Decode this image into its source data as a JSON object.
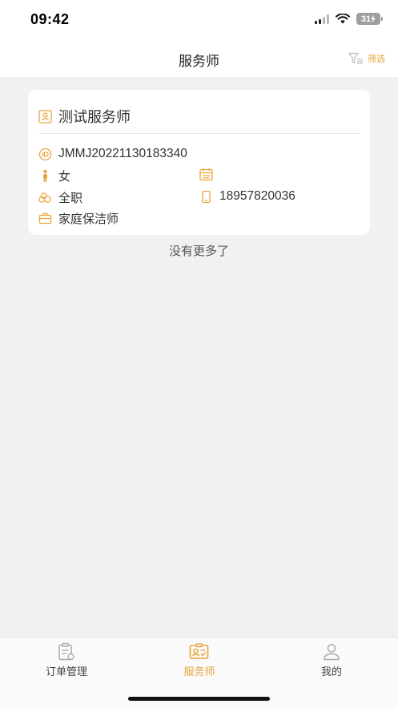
{
  "status_bar": {
    "time": "09:42",
    "battery": "31"
  },
  "nav": {
    "title": "服务师",
    "filter_label": "筛选"
  },
  "card": {
    "name": "测试服务师",
    "code": "JMMJ2022113018334​0",
    "gender": "女",
    "birthday": "",
    "employment": "全职",
    "phone": "18957820036",
    "service_type": "家庭保洁师"
  },
  "list_footer": "没有更多了",
  "tabs": [
    {
      "label": "订单管理",
      "icon": "order-icon",
      "active": false
    },
    {
      "label": "服务师",
      "icon": "worker-card-icon",
      "active": true
    },
    {
      "label": "我的",
      "icon": "user-icon",
      "active": false
    }
  ],
  "colors": {
    "accent": "#e8a43b",
    "background": "#f1f1f1"
  }
}
